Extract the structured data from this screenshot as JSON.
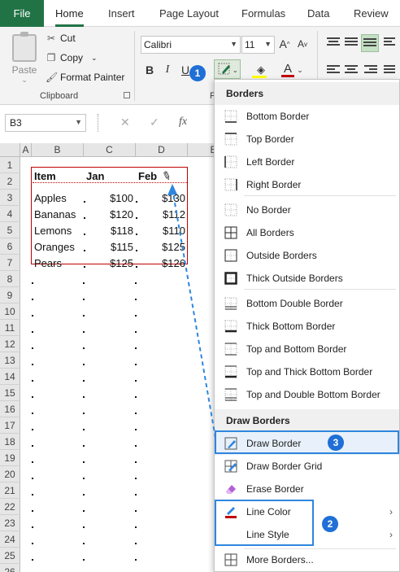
{
  "tabs": [
    "File",
    "Home",
    "Insert",
    "Page Layout",
    "Formulas",
    "Data",
    "Review"
  ],
  "clipboard": {
    "paste": "Paste",
    "cut": "Cut",
    "copy": "Copy",
    "format_painter": "Format Painter",
    "group_label": "Clipboard"
  },
  "font": {
    "name": "Calibri",
    "size": "11",
    "bold": "B",
    "italic": "I",
    "underline": "U",
    "grow": "A",
    "shrink": "A",
    "color_letter": "A",
    "group_label": "F"
  },
  "namebox": {
    "value": "B3",
    "fx": "fx"
  },
  "grid": {
    "columns": [
      "A",
      "B",
      "C",
      "D",
      "E"
    ],
    "rows": [
      "1",
      "2",
      "3",
      "4",
      "5",
      "6",
      "7",
      "8",
      "9",
      "10",
      "11",
      "12",
      "13",
      "14",
      "15",
      "16",
      "17",
      "18",
      "19",
      "20",
      "21",
      "22",
      "23",
      "24",
      "25",
      "26"
    ],
    "table_header": [
      "Item",
      "Jan",
      "Feb"
    ],
    "table_rows": [
      [
        "Apples",
        "$100",
        "$130"
      ],
      [
        "Bananas",
        "$120",
        "$112"
      ],
      [
        "Lemons",
        "$118",
        "$110"
      ],
      [
        "Oranges",
        "$115",
        "$125"
      ],
      [
        "Pears",
        "$125",
        "$126"
      ]
    ]
  },
  "menu": {
    "section_borders": "Borders",
    "items_borders": [
      {
        "label": "Bottom Border",
        "icon": "bottom-border-icon"
      },
      {
        "label": "Top Border",
        "icon": "top-border-icon"
      },
      {
        "label": "Left Border",
        "icon": "left-border-icon"
      },
      {
        "label": "Right Border",
        "icon": "right-border-icon"
      },
      {
        "label": "No Border",
        "icon": "no-border-icon"
      },
      {
        "label": "All Borders",
        "icon": "all-borders-icon"
      },
      {
        "label": "Outside Borders",
        "icon": "outside-borders-icon"
      },
      {
        "label": "Thick Outside Borders",
        "icon": "thick-outside-borders-icon"
      },
      {
        "label": "Bottom Double Border",
        "icon": "bottom-double-border-icon"
      },
      {
        "label": "Thick Bottom Border",
        "icon": "thick-bottom-border-icon"
      },
      {
        "label": "Top and Bottom Border",
        "icon": "top-bottom-border-icon"
      },
      {
        "label": "Top and Thick Bottom Border",
        "icon": "top-thick-bottom-border-icon"
      },
      {
        "label": "Top and Double Bottom Border",
        "icon": "top-double-bottom-border-icon"
      }
    ],
    "section_draw": "Draw Borders",
    "items_draw": [
      {
        "label": "Draw Border",
        "icon": "draw-border-icon"
      },
      {
        "label": "Draw Border Grid",
        "icon": "draw-border-grid-icon"
      },
      {
        "label": "Erase Border",
        "icon": "eraser-icon"
      },
      {
        "label": "Line Color",
        "icon": "line-color-icon"
      },
      {
        "label": "Line Style",
        "icon": "line-style-icon"
      }
    ],
    "more": "More Borders...",
    "submenu_arrow": "›"
  },
  "badges": [
    "1",
    "2",
    "3"
  ],
  "colors": {
    "excel_green": "#217346",
    "table_border": "#c00000",
    "highlight_blue": "#2e86de",
    "badge_blue": "#1f6fd6",
    "selected_bg": "#e8f1fb"
  }
}
